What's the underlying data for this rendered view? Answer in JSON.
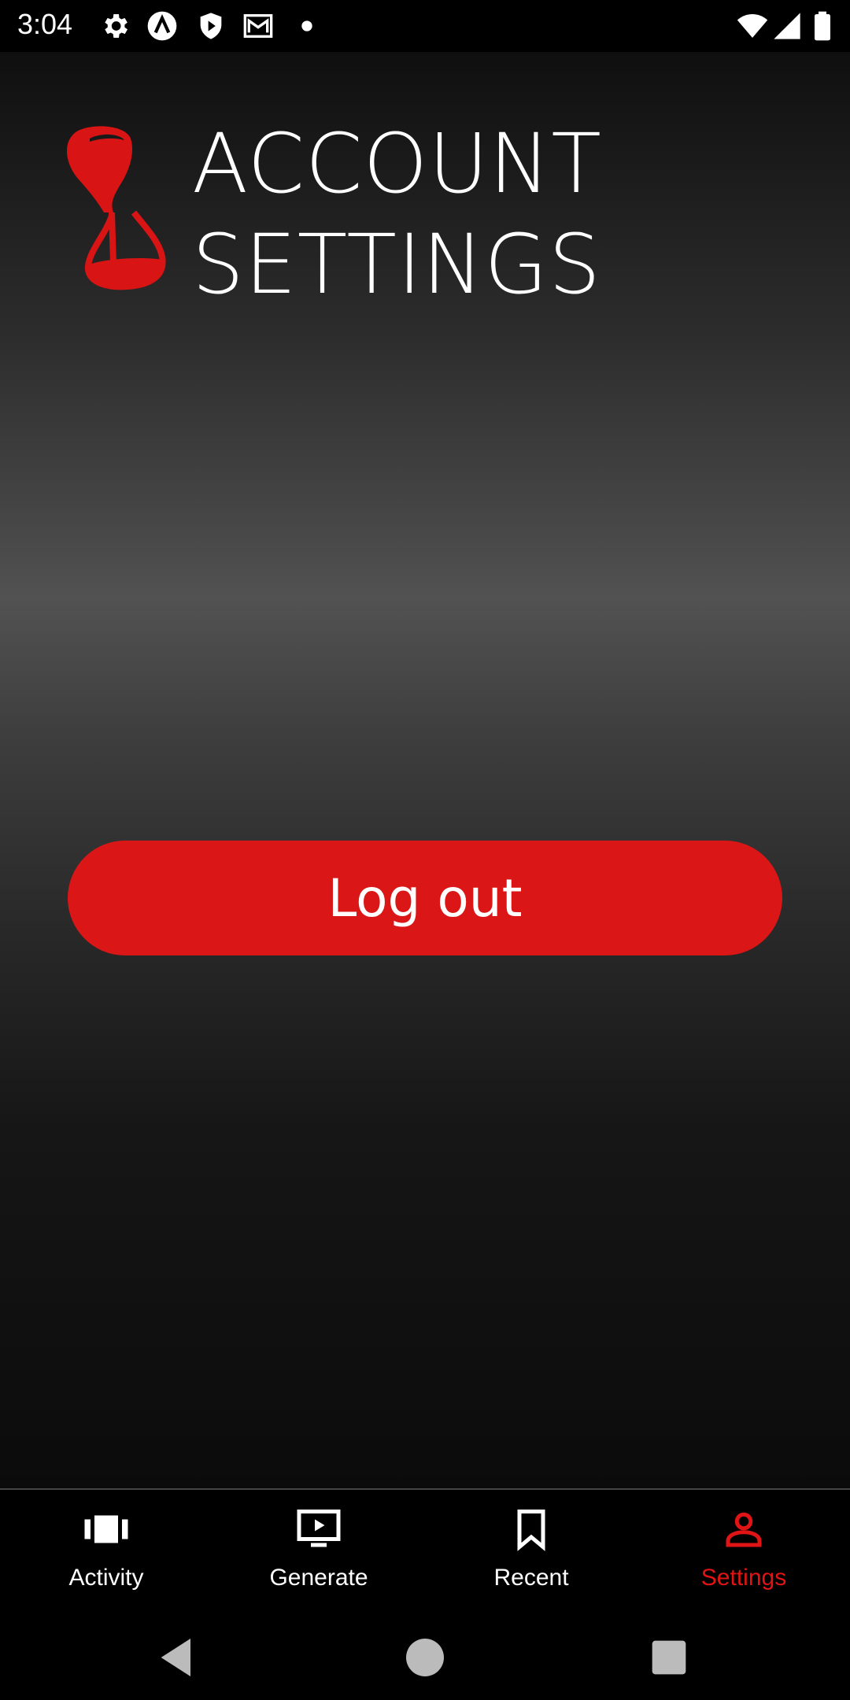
{
  "status_bar": {
    "time": "3:04",
    "left_icons": [
      "settings-icon",
      "triangle-a-icon",
      "shield-play-icon",
      "mail-icon",
      "dot-icon"
    ],
    "right_icons": [
      "wifi-icon",
      "signal-icon",
      "battery-icon"
    ]
  },
  "header": {
    "logo": "hourglass-logo",
    "title_line1": "ACCOUNT",
    "title_line2": "SETTINGS"
  },
  "main": {
    "logout_label": "Log out"
  },
  "bottom_nav": {
    "items": [
      {
        "label": "Activity",
        "icon": "activity-icon",
        "active": false
      },
      {
        "label": "Generate",
        "icon": "play-screen-icon",
        "active": false
      },
      {
        "label": "Recent",
        "icon": "bookmark-icon",
        "active": false
      },
      {
        "label": "Settings",
        "icon": "person-icon",
        "active": true
      }
    ]
  },
  "system_nav": {
    "buttons": [
      "back-icon",
      "home-icon",
      "recents-icon"
    ]
  },
  "colors": {
    "accent": "#db1616",
    "active_nav": "#e01414",
    "background_top": "#0f0f0f",
    "background_mid": "#525252"
  }
}
